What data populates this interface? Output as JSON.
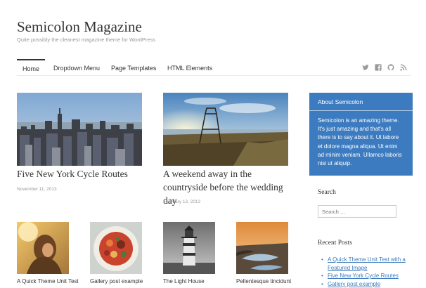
{
  "site": {
    "title": "Semicolon Magazine",
    "description": "Quite possibly the cleanest magazine theme for WordPress"
  },
  "nav": {
    "items": [
      "Home",
      "Dropdown Menu",
      "Page Templates",
      "HTML Elements"
    ],
    "social_icons": [
      "twitter-icon",
      "facebook-icon",
      "github-icon",
      "rss-icon"
    ]
  },
  "featured_posts": [
    {
      "title": "Five New York Cycle Routes",
      "date": "November 11, 2013"
    },
    {
      "title": "A weekend away in the countryside before the wedding day",
      "date": "February 13, 2012"
    }
  ],
  "small_posts": [
    {
      "title": "A Quick Theme Unit Test"
    },
    {
      "title": "Gallery post example"
    },
    {
      "title": "The Light House"
    },
    {
      "title": "Pellentesque tincidunt"
    }
  ],
  "sidebar": {
    "about": {
      "title": "About Semicolon",
      "text": "Semicolon is an amazing theme. It's just amazing and that's all there is to say about it. Ut labore et dolore magna aliqua. Ut enim ad minim veniam. Ullamco laboris nisi ut aliquip."
    },
    "search": {
      "title": "Search",
      "placeholder": "Search …"
    },
    "recent": {
      "title": "Recent Posts",
      "items": [
        "A Quick Theme Unit Test with a Featured Image",
        "Five New York Cycle Routes",
        "Gallery post example"
      ]
    }
  },
  "colors": {
    "accent": "#3c7bbf",
    "text": "#333333",
    "muted": "#999999"
  }
}
